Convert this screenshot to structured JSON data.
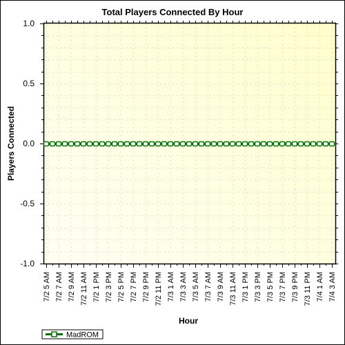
{
  "chart_data": {
    "type": "line",
    "title": "Total Players Connected By Hour",
    "xlabel": "Hour",
    "ylabel": "Players Connected",
    "ylim": [
      -1.0,
      1.0
    ],
    "yticks": [
      "1.0",
      "0.5",
      "0.0",
      "-0.5",
      "-1.0"
    ],
    "ytick_values": [
      1.0,
      0.5,
      0.0,
      -0.5,
      -1.0
    ],
    "y_minor_step": 0.1,
    "grid": true,
    "legend_position": "bottom-left",
    "x_tick_labels": [
      "7/2 5 AM",
      "7/2 7 AM",
      "7/2 9 AM",
      "7/2 11 AM",
      "7/2 1 PM",
      "7/2 3 PM",
      "7/2 5 PM",
      "7/2 7 PM",
      "7/2 9 PM",
      "7/2 11 PM",
      "7/3 1 AM",
      "7/3 3 AM",
      "7/3 5 AM",
      "7/3 7 AM",
      "7/3 9 AM",
      "7/3 11 AM",
      "7/3 1 PM",
      "7/3 3 PM",
      "7/3 5 PM",
      "7/3 7 PM",
      "7/3 9 PM",
      "7/3 11 PM",
      "7/4 1 AM",
      "7/4 3 AM"
    ],
    "x_points_per_label": 2,
    "series": [
      {
        "name": "MadROM",
        "color": "#007000",
        "marker": "hollow-square",
        "values": [
          0,
          0,
          0,
          0,
          0,
          0,
          0,
          0,
          0,
          0,
          0,
          0,
          0,
          0,
          0,
          0,
          0,
          0,
          0,
          0,
          0,
          0,
          0,
          0,
          0,
          0,
          0,
          0,
          0,
          0,
          0,
          0,
          0,
          0,
          0,
          0,
          0,
          0,
          0,
          0,
          0,
          0,
          0,
          0,
          0,
          0,
          0
        ]
      }
    ]
  },
  "colors": {
    "plot_bg_start": "#fffff4",
    "plot_bg_end": "#ffffcc",
    "grid": "#c8c8c8",
    "axis": "#000000"
  }
}
